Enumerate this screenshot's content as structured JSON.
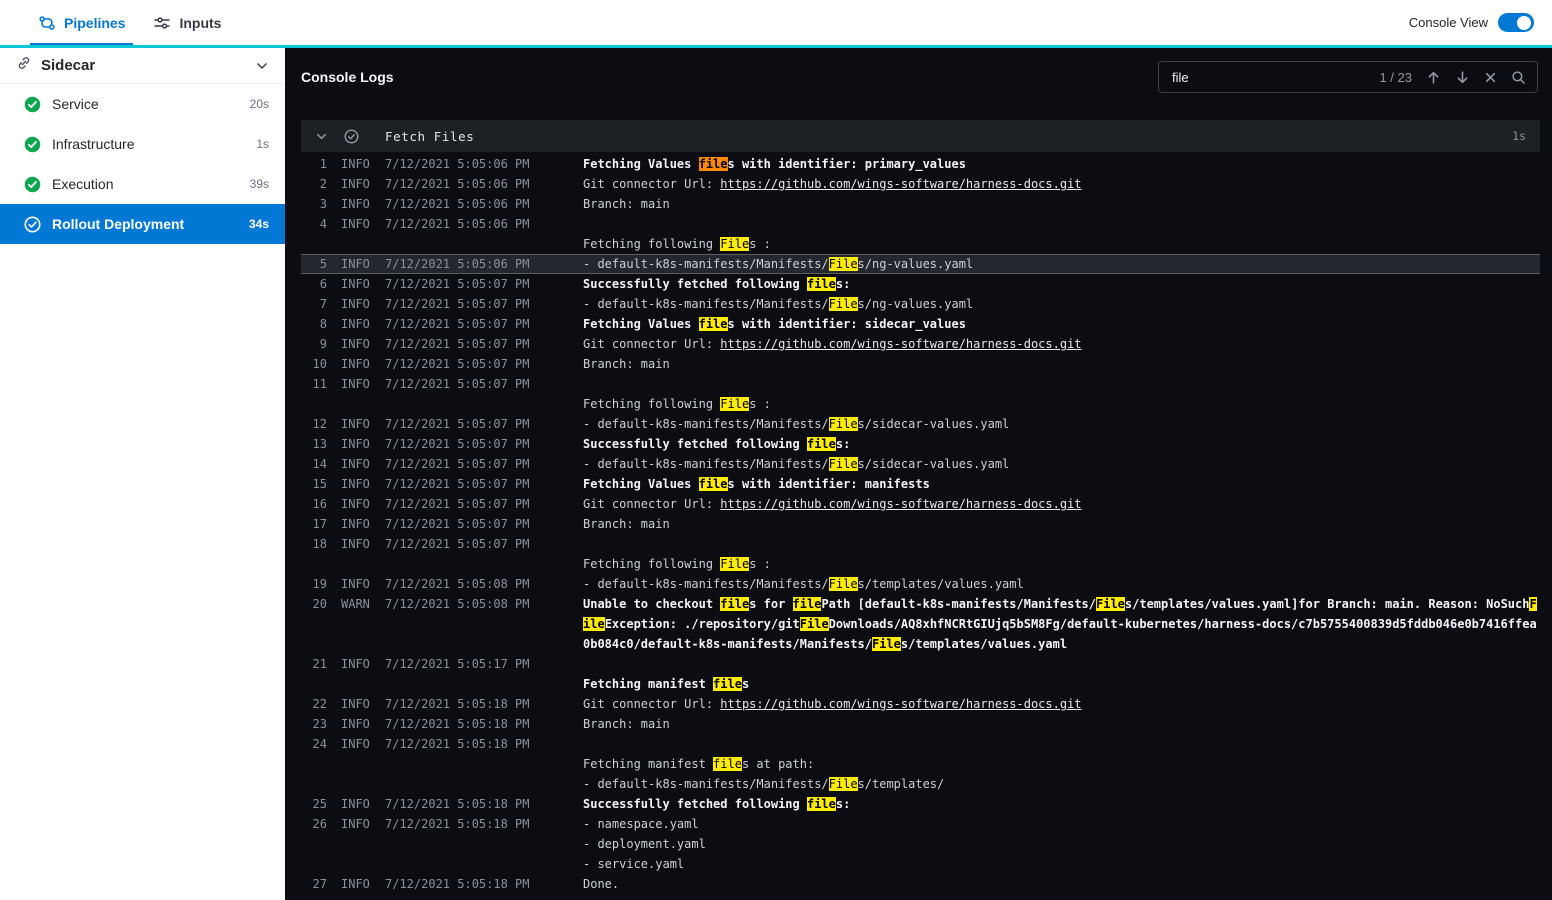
{
  "topbar": {
    "tabs": [
      {
        "label": "Pipelines",
        "active": true
      },
      {
        "label": "Inputs",
        "active": false
      }
    ],
    "console_view_label": "Console View",
    "console_view_on": true
  },
  "sidebar": {
    "title": "Sidecar",
    "items": [
      {
        "label": "Service",
        "duration": "20s",
        "status": "success",
        "selected": false
      },
      {
        "label": "Infrastructure",
        "duration": "1s",
        "status": "success",
        "selected": false
      },
      {
        "label": "Execution",
        "duration": "39s",
        "status": "success",
        "selected": false
      },
      {
        "label": "Rollout Deployment",
        "duration": "34s",
        "status": "success",
        "selected": true
      }
    ]
  },
  "console": {
    "title": "Console Logs",
    "search": {
      "value": "file",
      "match_position": "1 / 23"
    },
    "section": {
      "title": "Fetch Files",
      "duration": "1s"
    },
    "rows": [
      {
        "num": "1",
        "level": "INFO",
        "time": "7/12/2021 5:05:06 PM",
        "bold": true,
        "segments": [
          {
            "t": "Fetching Values "
          },
          {
            "t": "file",
            "hl": "current"
          },
          {
            "t": "s with identifier: primary_values"
          }
        ]
      },
      {
        "num": "2",
        "level": "INFO",
        "time": "7/12/2021 5:05:06 PM",
        "segments": [
          {
            "t": "Git connector Url: "
          },
          {
            "t": "https://github.com/wings-software/harness-docs.git",
            "link": true
          }
        ]
      },
      {
        "num": "3",
        "level": "INFO",
        "time": "7/12/2021 5:05:06 PM",
        "segments": [
          {
            "t": "Branch: main"
          }
        ]
      },
      {
        "num": "4",
        "level": "INFO",
        "time": "7/12/2021 5:05:06 PM",
        "segments": []
      },
      {
        "segments": [
          {
            "t": "Fetching following "
          },
          {
            "t": "File",
            "hl": "match"
          },
          {
            "t": "s :"
          }
        ]
      },
      {
        "num": "5",
        "level": "INFO",
        "time": "7/12/2021 5:05:06 PM",
        "selected": true,
        "segments": [
          {
            "t": "- default-k8s-manifests/Manifests/"
          },
          {
            "t": "File",
            "hl": "match"
          },
          {
            "t": "s/ng-values.yaml"
          }
        ]
      },
      {
        "num": "6",
        "level": "INFO",
        "time": "7/12/2021 5:05:07 PM",
        "bold": true,
        "segments": [
          {
            "t": "Successfully fetched following "
          },
          {
            "t": "file",
            "hl": "match"
          },
          {
            "t": "s:"
          }
        ]
      },
      {
        "num": "7",
        "level": "INFO",
        "time": "7/12/2021 5:05:07 PM",
        "segments": [
          {
            "t": "- default-k8s-manifests/Manifests/"
          },
          {
            "t": "File",
            "hl": "match"
          },
          {
            "t": "s/ng-values.yaml"
          }
        ]
      },
      {
        "num": "8",
        "level": "INFO",
        "time": "7/12/2021 5:05:07 PM",
        "bold": true,
        "segments": [
          {
            "t": "Fetching Values "
          },
          {
            "t": "file",
            "hl": "match"
          },
          {
            "t": "s with identifier: sidecar_values"
          }
        ]
      },
      {
        "num": "9",
        "level": "INFO",
        "time": "7/12/2021 5:05:07 PM",
        "segments": [
          {
            "t": "Git connector Url: "
          },
          {
            "t": "https://github.com/wings-software/harness-docs.git",
            "link": true
          }
        ]
      },
      {
        "num": "10",
        "level": "INFO",
        "time": "7/12/2021 5:05:07 PM",
        "segments": [
          {
            "t": "Branch: main"
          }
        ]
      },
      {
        "num": "11",
        "level": "INFO",
        "time": "7/12/2021 5:05:07 PM",
        "segments": []
      },
      {
        "segments": [
          {
            "t": "Fetching following "
          },
          {
            "t": "File",
            "hl": "match"
          },
          {
            "t": "s :"
          }
        ]
      },
      {
        "num": "12",
        "level": "INFO",
        "time": "7/12/2021 5:05:07 PM",
        "segments": [
          {
            "t": "- default-k8s-manifests/Manifests/"
          },
          {
            "t": "File",
            "hl": "match"
          },
          {
            "t": "s/sidecar-values.yaml"
          }
        ]
      },
      {
        "num": "13",
        "level": "INFO",
        "time": "7/12/2021 5:05:07 PM",
        "bold": true,
        "segments": [
          {
            "t": "Successfully fetched following "
          },
          {
            "t": "file",
            "hl": "match"
          },
          {
            "t": "s:"
          }
        ]
      },
      {
        "num": "14",
        "level": "INFO",
        "time": "7/12/2021 5:05:07 PM",
        "segments": [
          {
            "t": "- default-k8s-manifests/Manifests/"
          },
          {
            "t": "File",
            "hl": "match"
          },
          {
            "t": "s/sidecar-values.yaml"
          }
        ]
      },
      {
        "num": "15",
        "level": "INFO",
        "time": "7/12/2021 5:05:07 PM",
        "bold": true,
        "segments": [
          {
            "t": "Fetching Values "
          },
          {
            "t": "file",
            "hl": "match"
          },
          {
            "t": "s with identifier: manifests"
          }
        ]
      },
      {
        "num": "16",
        "level": "INFO",
        "time": "7/12/2021 5:05:07 PM",
        "segments": [
          {
            "t": "Git connector Url: "
          },
          {
            "t": "https://github.com/wings-software/harness-docs.git",
            "link": true
          }
        ]
      },
      {
        "num": "17",
        "level": "INFO",
        "time": "7/12/2021 5:05:07 PM",
        "segments": [
          {
            "t": "Branch: main"
          }
        ]
      },
      {
        "num": "18",
        "level": "INFO",
        "time": "7/12/2021 5:05:07 PM",
        "segments": []
      },
      {
        "segments": [
          {
            "t": "Fetching following "
          },
          {
            "t": "File",
            "hl": "match"
          },
          {
            "t": "s :"
          }
        ]
      },
      {
        "num": "19",
        "level": "INFO",
        "time": "7/12/2021 5:05:08 PM",
        "segments": [
          {
            "t": "- default-k8s-manifests/Manifests/"
          },
          {
            "t": "File",
            "hl": "match"
          },
          {
            "t": "s/templates/values.yaml"
          }
        ]
      },
      {
        "num": "20",
        "level": "WARN",
        "time": "7/12/2021 5:05:08 PM",
        "bold": true,
        "segments": [
          {
            "t": "Unable to checkout "
          },
          {
            "t": "file",
            "hl": "match"
          },
          {
            "t": "s for "
          },
          {
            "t": "file",
            "hl": "match"
          },
          {
            "t": "Path [default-k8s-manifests/Manifests/"
          },
          {
            "t": "File",
            "hl": "match"
          },
          {
            "t": "s/templates/values.yaml]for Branch: main. Reason: NoSuch"
          },
          {
            "t": "File",
            "hl": "match"
          },
          {
            "t": "Exception: ./repository/git"
          },
          {
            "t": "File",
            "hl": "match"
          },
          {
            "t": "Downloads/AQ8xhfNCRtGIUjq5bSM8Fg/default-kubernetes/harness-docs/c7b5755400839d5fddb046e0b7416ffea0b084c0/default-k8s-manifests/Manifests/"
          },
          {
            "t": "File",
            "hl": "match"
          },
          {
            "t": "s/templates/values.yaml"
          }
        ]
      },
      {
        "num": "21",
        "level": "INFO",
        "time": "7/12/2021 5:05:17 PM",
        "segments": []
      },
      {
        "bold": true,
        "segments": [
          {
            "t": "Fetching manifest "
          },
          {
            "t": "file",
            "hl": "match"
          },
          {
            "t": "s"
          }
        ]
      },
      {
        "num": "22",
        "level": "INFO",
        "time": "7/12/2021 5:05:18 PM",
        "segments": [
          {
            "t": "Git connector Url: "
          },
          {
            "t": "https://github.com/wings-software/harness-docs.git",
            "link": true
          }
        ]
      },
      {
        "num": "23",
        "level": "INFO",
        "time": "7/12/2021 5:05:18 PM",
        "segments": [
          {
            "t": "Branch: main"
          }
        ]
      },
      {
        "num": "24",
        "level": "INFO",
        "time": "7/12/2021 5:05:18 PM",
        "segments": []
      },
      {
        "segments": [
          {
            "t": "Fetching manifest "
          },
          {
            "t": "file",
            "hl": "match"
          },
          {
            "t": "s at path:"
          }
        ]
      },
      {
        "segments": [
          {
            "t": "- default-k8s-manifests/Manifests/"
          },
          {
            "t": "File",
            "hl": "match"
          },
          {
            "t": "s/templates/"
          }
        ]
      },
      {
        "num": "25",
        "level": "INFO",
        "time": "7/12/2021 5:05:18 PM",
        "bold": true,
        "segments": [
          {
            "t": "Successfully fetched following "
          },
          {
            "t": "file",
            "hl": "match"
          },
          {
            "t": "s:"
          }
        ]
      },
      {
        "num": "26",
        "level": "INFO",
        "time": "7/12/2021 5:05:18 PM",
        "segments": [
          {
            "t": "- namespace.yaml"
          }
        ]
      },
      {
        "segments": [
          {
            "t": "- deployment.yaml"
          }
        ]
      },
      {
        "segments": [
          {
            "t": "- service.yaml"
          }
        ]
      },
      {
        "num": "27",
        "level": "INFO",
        "time": "7/12/2021 5:05:18 PM",
        "segments": [
          {
            "t": "Done."
          }
        ]
      }
    ]
  },
  "colors": {
    "primary_blue": "#0278d5",
    "accent_teal": "#0bc8d6",
    "success_green": "#0ca750",
    "console_background": "#0b0d12",
    "search_highlight": "#ffeb00",
    "search_highlight_current": "#ff8800"
  }
}
